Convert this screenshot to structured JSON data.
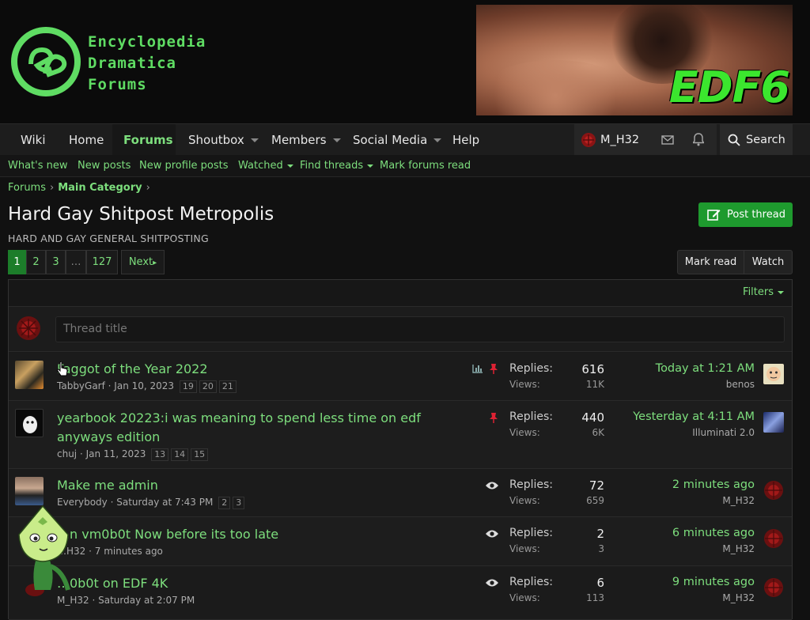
{
  "header": {
    "logo_text_1": "Encyclopedia",
    "logo_text_2": "Dramatica",
    "logo_text_3": "Forums",
    "banner_text": "EDF6"
  },
  "nav": {
    "items": [
      {
        "label": "Wiki"
      },
      {
        "label": "Home"
      },
      {
        "label": "Forums"
      },
      {
        "label": "Shoutbox"
      },
      {
        "label": "Members"
      },
      {
        "label": "Social Media"
      },
      {
        "label": "Help"
      }
    ],
    "user": "M_H32",
    "search": "Search"
  },
  "subnav": {
    "items": [
      "What's new",
      "New posts",
      "New profile posts",
      "Watched",
      "Find threads",
      "Mark forums read"
    ]
  },
  "breadcrumb": [
    "Forums",
    "Main Category"
  ],
  "page": {
    "title": "Hard Gay Shitpost Metropolis",
    "description": "HARD AND GAY GENERAL SHITPOSTING",
    "post_thread": "Post thread",
    "mark_read": "Mark read",
    "watch": "Watch"
  },
  "pagination": {
    "pages": [
      "1",
      "2",
      "3",
      "…",
      "127"
    ],
    "next": "Next"
  },
  "list": {
    "filters": "Filters",
    "quick_placeholder": "Thread title",
    "replies_label": "Replies:",
    "views_label": "Views:"
  },
  "threads": [
    {
      "title": "Faggot of the Year 2022",
      "title2": "",
      "author": "TabbyGarf",
      "date": "Jan 10, 2023",
      "pages": [
        "19",
        "20",
        "21"
      ],
      "replies": "616",
      "views": "11K",
      "last_time": "Today at 1:21 AM",
      "last_user": "benos"
    },
    {
      "title": "yearbook 20223:i was meaning to spend less time on edf",
      "title2": "anyways edition",
      "author": "chuj",
      "date": "Jan 11, 2023",
      "pages": [
        "13",
        "14",
        "15"
      ],
      "replies": "440",
      "views": "6K",
      "last_time": "Yesterday at 4:11 AM",
      "last_user": "Illuminati 2.0"
    },
    {
      "title": "Make me admin",
      "title2": "",
      "author": "Everybody",
      "date": "Saturday at 7:43 PM",
      "pages": [
        "2",
        "3"
      ],
      "replies": "72",
      "views": "659",
      "last_time": "2 minutes ago",
      "last_user": "M_H32"
    },
    {
      "title": "…n vm0b0t Now before its too late",
      "title2": "",
      "author": "…H32",
      "date": "7 minutes ago",
      "pages": [],
      "replies": "2",
      "views": "3",
      "last_time": "6 minutes ago",
      "last_user": "M_H32"
    },
    {
      "title": "…0b0t on EDF 4K",
      "title2": "",
      "author": "M_H32",
      "date": "Saturday at 2:07 PM",
      "pages": [],
      "replies": "6",
      "views": "113",
      "last_time": "9 minutes ago",
      "last_user": "M_H32"
    }
  ]
}
